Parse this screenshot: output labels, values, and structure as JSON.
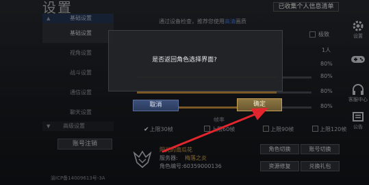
{
  "header": {
    "title": "设置",
    "info_link": "已收集个人信息清单",
    "hint_prefix": "通过设备检查，推荐您使用",
    "hint_accent": "高清",
    "hint_suffix": "画质"
  },
  "menu": {
    "group_top": "基础设置",
    "items": [
      "基础设置",
      "视角设置",
      "战斗设置",
      "通信设置",
      "聊天设置"
    ],
    "group_bottom": "高级设置",
    "logout": "账号注销"
  },
  "settings": {
    "option_label": "极致",
    "people_value": "1人",
    "values": [
      "80%",
      "80%",
      "80%",
      "80%"
    ],
    "slider_levels": [
      0.8,
      0.8,
      0.8,
      0.8
    ],
    "fps_label": "帧率",
    "fps_options": [
      {
        "label": "上限30帧",
        "checked": true
      },
      {
        "label": "上限60帧",
        "checked": false
      },
      {
        "label": "上限90帧",
        "checked": false
      },
      {
        "label": "上限120帧",
        "checked": false
      }
    ]
  },
  "profile": {
    "name": "阳光的南瓜花",
    "server_label": "服务器:",
    "server": "梅落之炎",
    "role_id": "角色编号:60359000136"
  },
  "actions": {
    "switch_role": "角色切换",
    "switch_account": "账号切换",
    "repair": "资源修复",
    "redeem": "兑换礼包"
  },
  "side": {
    "settings": "设置",
    "service": "客服中心",
    "notice": "公告"
  },
  "footer": {
    "icp": "渝ICP备14009613号-3A"
  },
  "dialog": {
    "message": "是否返回角色选择界面?",
    "cancel": "取消",
    "confirm": "确定"
  },
  "colors": {
    "accent_gold": "#c7a258",
    "accent_blue": "#3e6fd1",
    "arrow_red": "#e3262d"
  }
}
